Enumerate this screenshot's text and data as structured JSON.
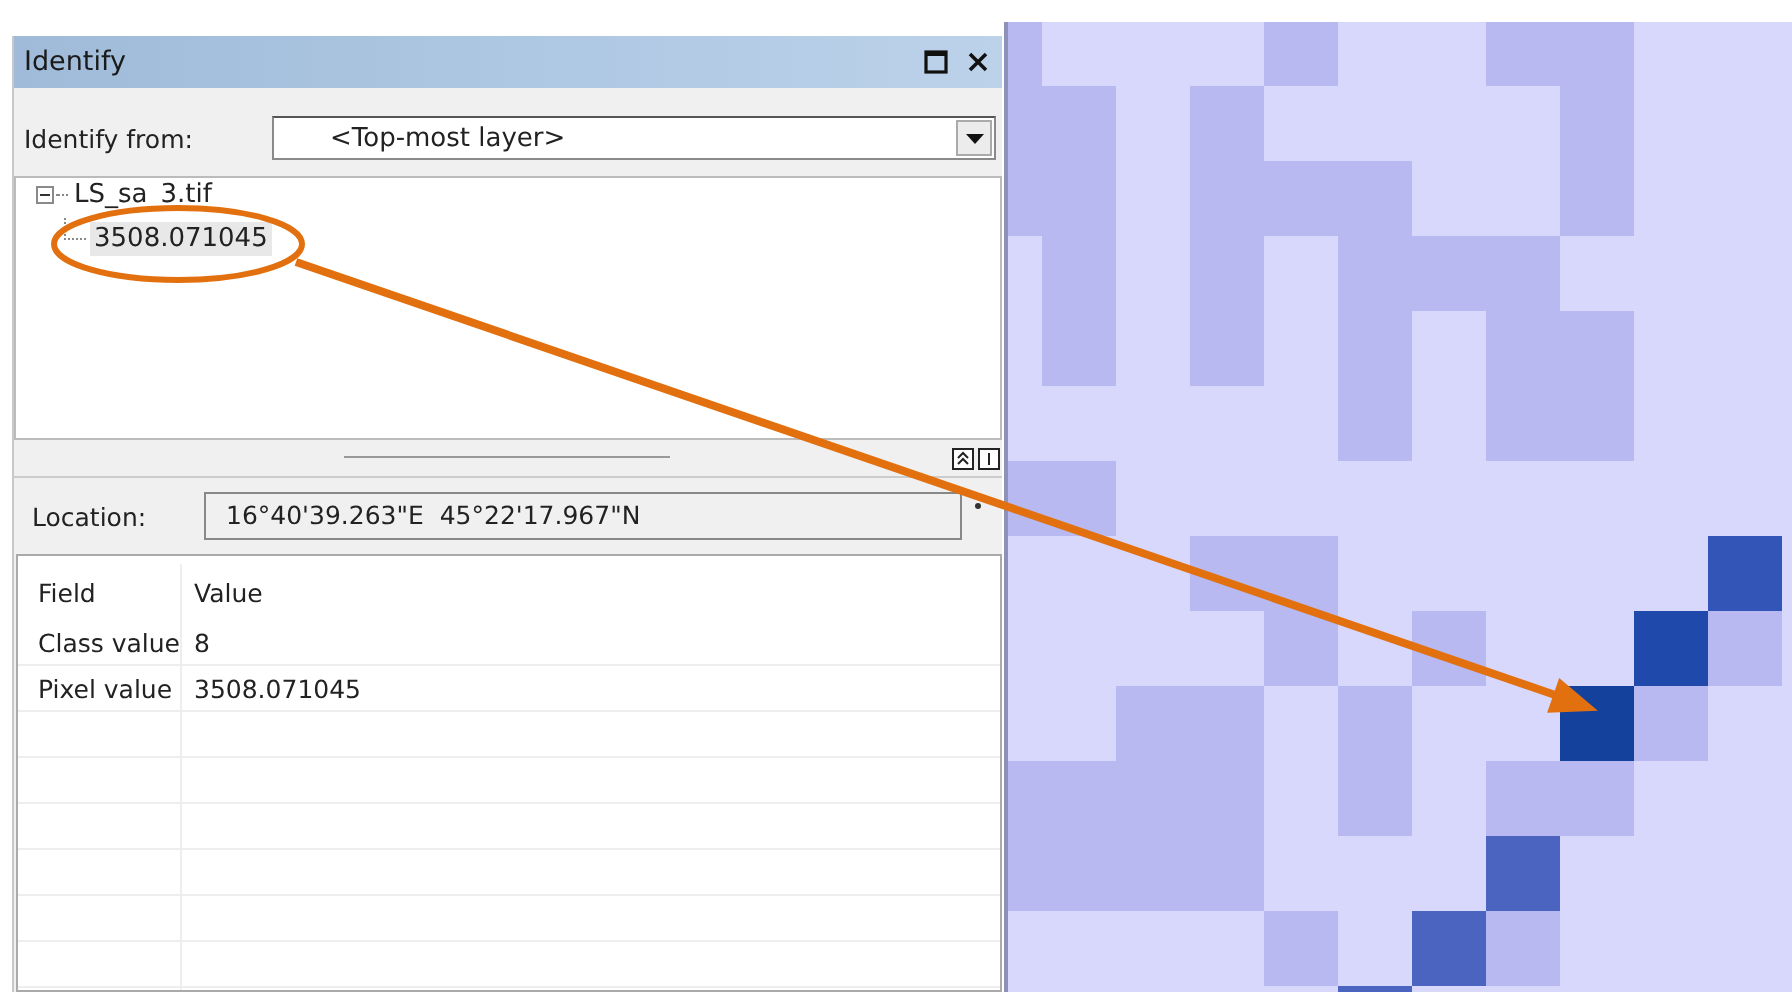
{
  "panel": {
    "title": "Identify",
    "identify_from": {
      "label": "Identify from:",
      "value": "<Top-most layer>"
    },
    "tree": [
      {
        "label": "LS_sa_3.tif",
        "expanded": true,
        "selected": false,
        "children": [
          {
            "label": "3508.071045",
            "selected": true
          }
        ]
      }
    ],
    "location": {
      "label": "Location:",
      "value": "16°40'39.263\"E  45°22'17.967\"N"
    },
    "table": {
      "columns": [
        "Field",
        "Value"
      ],
      "rows": [
        [
          "Class value",
          "8"
        ],
        [
          "Pixel value",
          "3508.071045"
        ]
      ]
    }
  }
}
